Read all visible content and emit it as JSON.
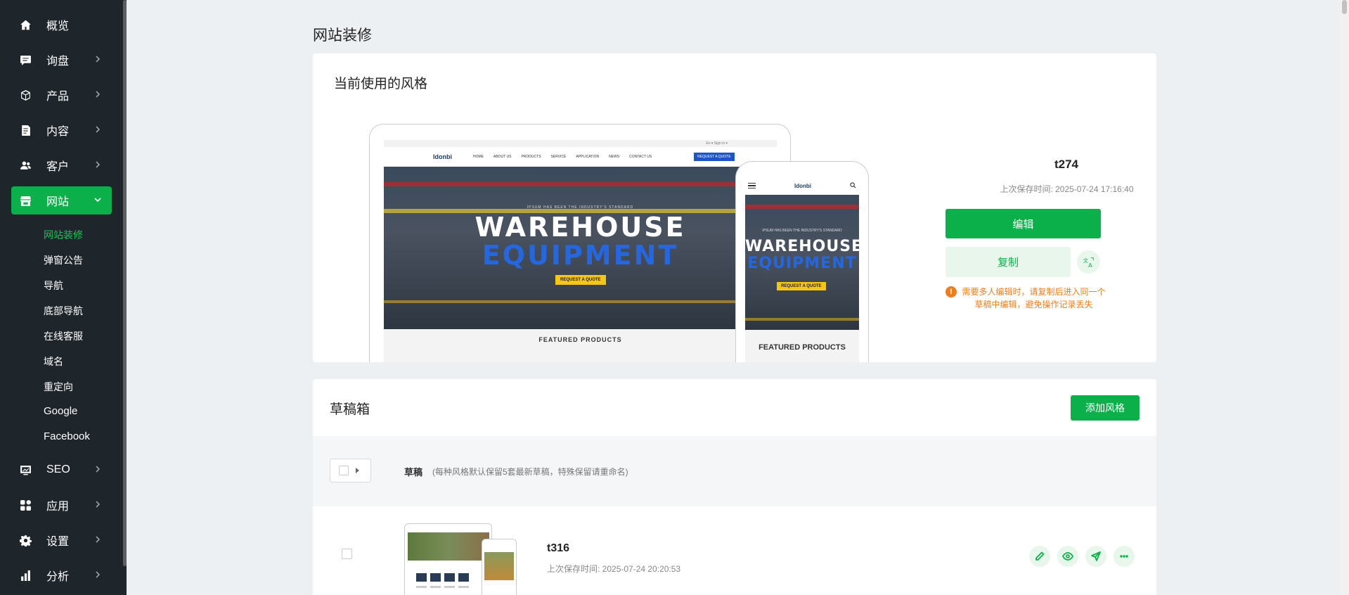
{
  "sidebar": {
    "items": [
      {
        "label": "概览",
        "icon": "home-icon",
        "has_chevron": false
      },
      {
        "label": "询盘",
        "icon": "message-icon",
        "has_chevron": true
      },
      {
        "label": "产品",
        "icon": "box-icon",
        "has_chevron": true
      },
      {
        "label": "内容",
        "icon": "document-icon",
        "has_chevron": true
      },
      {
        "label": "客户",
        "icon": "users-icon",
        "has_chevron": true
      },
      {
        "label": "网站",
        "icon": "store-icon",
        "has_chevron": true,
        "active": true
      },
      {
        "label": "SEO",
        "icon": "chart-screen-icon",
        "has_chevron": true
      },
      {
        "label": "应用",
        "icon": "apps-icon",
        "has_chevron": true
      },
      {
        "label": "设置",
        "icon": "gear-icon",
        "has_chevron": true
      },
      {
        "label": "分析",
        "icon": "bar-chart-icon",
        "has_chevron": true
      }
    ],
    "website_sub": [
      {
        "label": "网站装修",
        "active": true
      },
      {
        "label": "弹窗公告"
      },
      {
        "label": "导航"
      },
      {
        "label": "底部导航"
      },
      {
        "label": "在线客服"
      },
      {
        "label": "域名"
      },
      {
        "label": "重定向"
      },
      {
        "label": "Google"
      },
      {
        "label": "Facebook"
      }
    ]
  },
  "page": {
    "title": "网站装修"
  },
  "current_style": {
    "section_title": "当前使用的风格",
    "name": "t274",
    "saved_time": "上次保存时间: 2025-07-24 17:16:40",
    "edit_label": "编辑",
    "copy_label": "复制",
    "warning": "需要多人编辑时，请复制后进入同一个草稿中编辑，避免操作记录丢失",
    "preview": {
      "logo": "Idonbi",
      "top_links": "En ▾   Sign in ▾",
      "menu": [
        "HOME",
        "ABOUT US",
        "PRODUCTS",
        "SERVICE",
        "APPLICATION",
        "NEWS",
        "CONTACT US"
      ],
      "quote_button": "REQUEST A QUOTE",
      "hero_small": "IPSUM HAS BEEN THE INDUSTRY'S STANDARD",
      "hero_line1": "WAREHOUSE",
      "hero_line2": "EQUIPMENT",
      "hero_button": "REQUEST A QUOTE",
      "featured": "FEATURED PRODUCTS"
    }
  },
  "drafts": {
    "section_title": "草稿箱",
    "add_label": "添加风格",
    "group_title": "草稿",
    "group_note": "(每种风格默认保留5套最新草稿，特殊保留请重命名)",
    "rows": [
      {
        "name": "t316",
        "saved_time": "上次保存时间: 2025-07-24 20:20:53"
      }
    ]
  },
  "colors": {
    "accent": "#0bb04b",
    "sidebar_bg": "#1e252b",
    "warning": "#f07d1c"
  }
}
